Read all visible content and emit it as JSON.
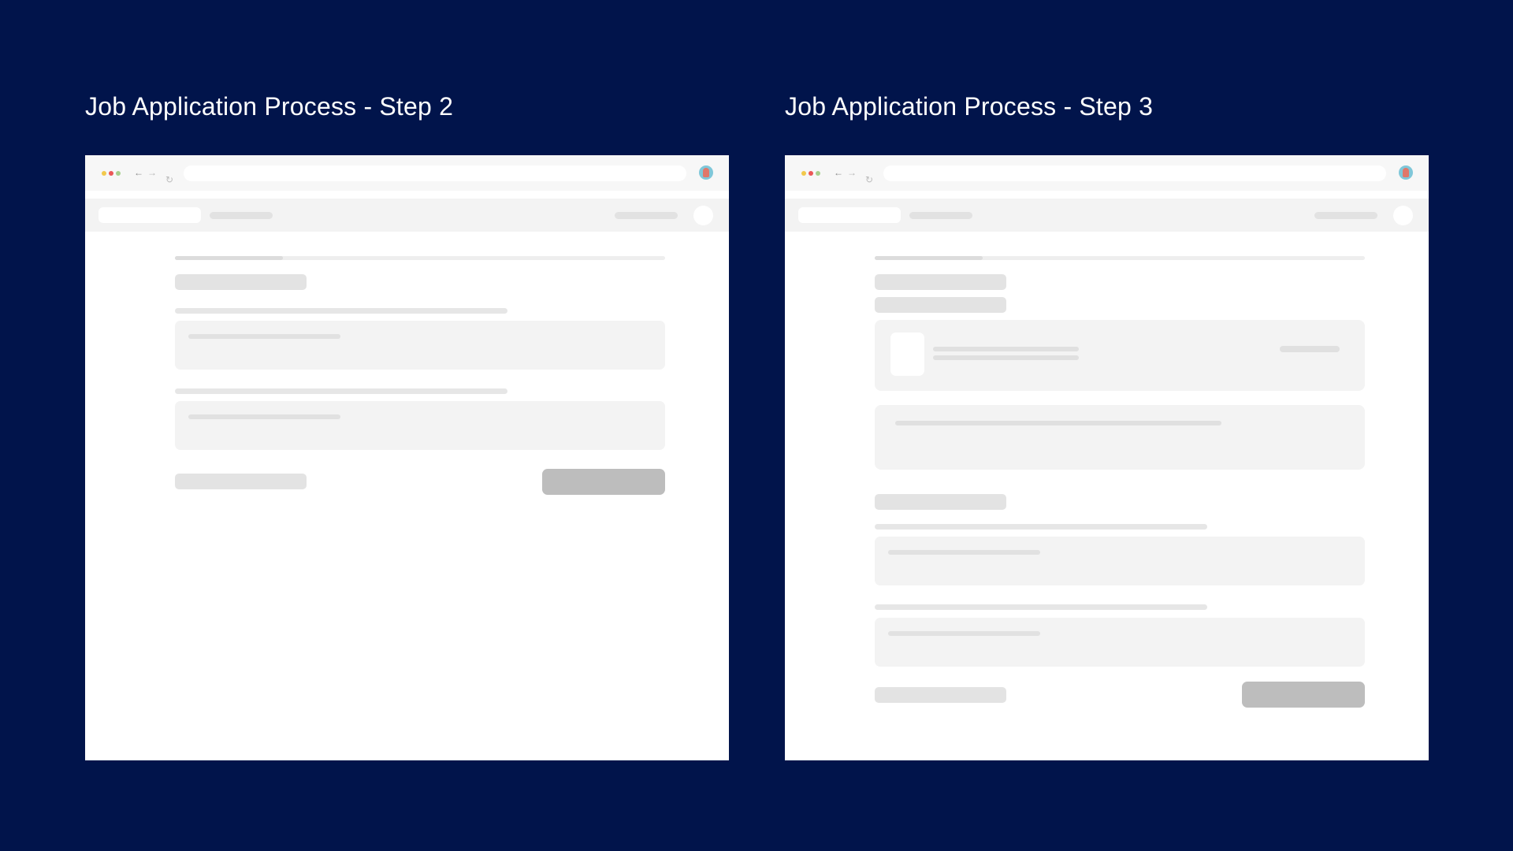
{
  "panels": [
    {
      "title": "Job Application Process - Step 2",
      "progress_fraction": 0.22
    },
    {
      "title": "Job Application Process - Step 3",
      "progress_fraction": 0.22
    }
  ],
  "icons": {
    "back": "arrow-left-icon",
    "forward": "arrow-right-icon",
    "reload": "reload-icon",
    "profile": "profile-avatar-icon"
  },
  "glyphs": {
    "back": "←",
    "forward": "→",
    "reload": "↻"
  },
  "colors": {
    "background": "#01144b",
    "title_text": "#ffffff",
    "window": "#ffffff",
    "placeholder_light": "#f3f3f3",
    "placeholder_mid": "#e3e3e3",
    "primary_button": "#bdbdbd",
    "traffic_light_yellow": "#f2c94c",
    "traffic_light_red": "#eb5757",
    "traffic_light_green": "#a8d08d"
  }
}
